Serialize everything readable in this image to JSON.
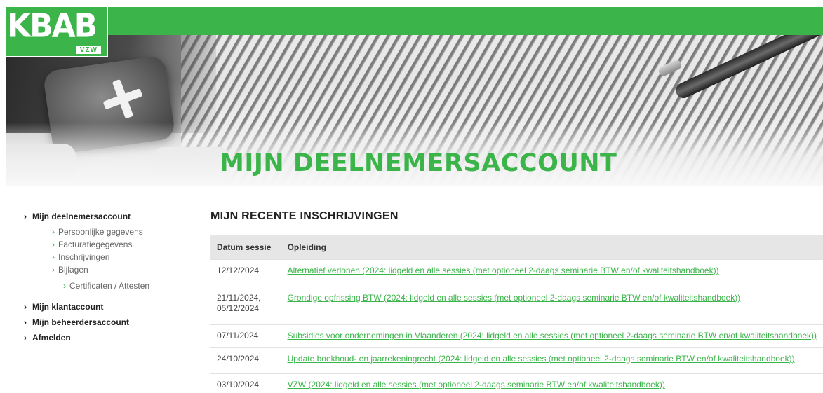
{
  "logo": {
    "main": "KBAB",
    "sub": "VZW"
  },
  "banner": {
    "title": "MIJN DEELNEMERSACCOUNT"
  },
  "sidebar": {
    "main_1": "Mijn deelnemersaccount",
    "sub_items": [
      "Persoonlijke gegevens",
      "Facturatiegegevens",
      "Inschrijvingen",
      "Bijlagen"
    ],
    "subsub_item": "Certificaten / Attesten",
    "main_2": "Mijn klantaccount",
    "main_3": "Mijn beheerdersaccount",
    "main_4": "Afmelden"
  },
  "main": {
    "title": "MIJN RECENTE INSCHRIJVINGEN",
    "columns": [
      "Datum sessie",
      "Opleiding"
    ],
    "rows": [
      {
        "date": "12/12/2024",
        "course": "Alternatief verlonen (2024: lidgeld en alle sessies (met optioneel 2-daags seminarie BTW en/of kwaliteitshandboek))"
      },
      {
        "date": "21/11/2024,",
        "date2": "05/12/2024",
        "course": "Grondige opfrissing BTW (2024: lidgeld en alle sessies (met optioneel 2-daags seminarie BTW en/of kwaliteitshandboek))"
      },
      {
        "date": "07/11/2024",
        "course": "Subsidies voor ondernemingen in Vlaanderen (2024: lidgeld en alle sessies (met optioneel 2-daags seminarie BTW en/of kwaliteitshandboek))"
      },
      {
        "date": "24/10/2024",
        "course": "Update boekhoud- en jaarrekeningrecht (2024: lidgeld en alle sessies (met optioneel 2-daags seminarie BTW en/of kwaliteitshandboek))"
      },
      {
        "date": "03/10/2024",
        "course": "VZW (2024: lidgeld en alle sessies (met optioneel 2-daags seminarie BTW en/of kwaliteitshandboek))"
      }
    ]
  },
  "colors": {
    "brand_green": "#3bb54a",
    "header_row": "#e6e6e6"
  },
  "icons": {
    "nav_chevron": "chevron-right-icon"
  }
}
